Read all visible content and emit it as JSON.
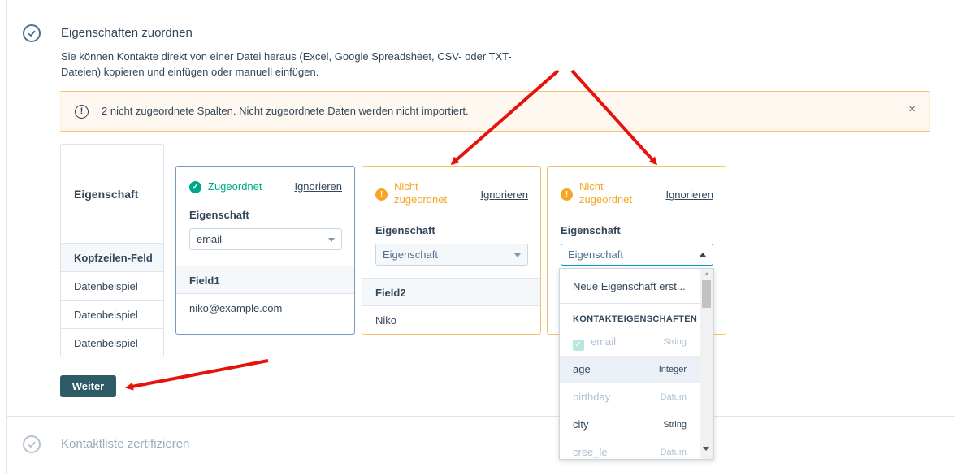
{
  "step1": {
    "title": "Eigenschaften zuordnen",
    "description": "Sie können Kontakte direkt von einer Datei heraus (Excel, Google Spreadsheet, CSV- oder TXT-Dateien) kopieren und einfügen oder manuell einfügen."
  },
  "alert": {
    "text": "2 nicht zugeordnete Spalten. Nicht zugeordnete Daten werden nicht importiert.",
    "close": "×"
  },
  "labels": {
    "property": "Eigenschaft",
    "header_field": "Kopfzeilen-Feld",
    "rows": [
      "Datenbeispiel",
      "Datenbeispiel",
      "Datenbeispiel"
    ]
  },
  "columns": [
    {
      "status": "Zugeordnet",
      "ignore": "Ignorieren",
      "property_label": "Eigenschaft",
      "selected": "email",
      "field": "Field1",
      "sample": "niko@example.com"
    },
    {
      "status": "Nicht zugeordnet",
      "ignore": "Ignorieren",
      "property_label": "Eigenschaft",
      "placeholder": "Eigenschaft",
      "field": "Field2",
      "sample": "Niko"
    },
    {
      "status": "Nicht zugeordnet",
      "ignore": "Ignorieren",
      "property_label": "Eigenschaft",
      "placeholder": "Eigenschaft"
    }
  ],
  "dropdown": {
    "create": "Neue Eigenschaft erst...",
    "group": "KONTAKTEIGENSCHAFTEN",
    "options": [
      {
        "name": "email",
        "type": "String"
      },
      {
        "name": "age",
        "type": "Integer"
      },
      {
        "name": "birthday",
        "type": "Datum"
      },
      {
        "name": "city",
        "type": "String"
      },
      {
        "name": "cree_le",
        "type": "Datum"
      }
    ]
  },
  "button": {
    "next": "Weiter"
  },
  "step2": {
    "title": "Kontaktliste zertifizieren"
  },
  "colors": {
    "success": "#00a88b",
    "warning": "#f5a623",
    "primary_button": "#2d5c67",
    "annotation_arrow": "#e8120c"
  }
}
